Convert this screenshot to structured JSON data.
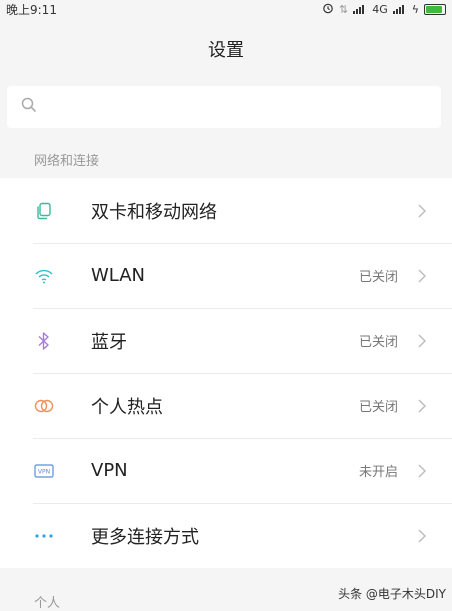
{
  "status_bar": {
    "time": "晚上9:11",
    "network": "4G",
    "colors": {
      "battery": "#3dbb3d"
    }
  },
  "header": {
    "title": "设置"
  },
  "search": {
    "placeholder": ""
  },
  "sections": {
    "network_title": "网络和连接",
    "personal_title": "个人"
  },
  "items": [
    {
      "label": "双卡和移动网络",
      "status": "",
      "icon": "sim-card-icon",
      "color": "#3bb89e"
    },
    {
      "label": "WLAN",
      "status": "已关闭",
      "icon": "wifi-icon",
      "color": "#31c0c8"
    },
    {
      "label": "蓝牙",
      "status": "已关闭",
      "icon": "bluetooth-icon",
      "color": "#a57be0"
    },
    {
      "label": "个人热点",
      "status": "已关闭",
      "icon": "hotspot-icon",
      "color": "#f0905a"
    },
    {
      "label": "VPN",
      "status": "未开启",
      "icon": "vpn-icon",
      "color": "#5b8fd8"
    },
    {
      "label": "更多连接方式",
      "status": "",
      "icon": "more-icon",
      "color": "#2fa3e6"
    }
  ],
  "watermark": "头条 @电子木头DIY"
}
